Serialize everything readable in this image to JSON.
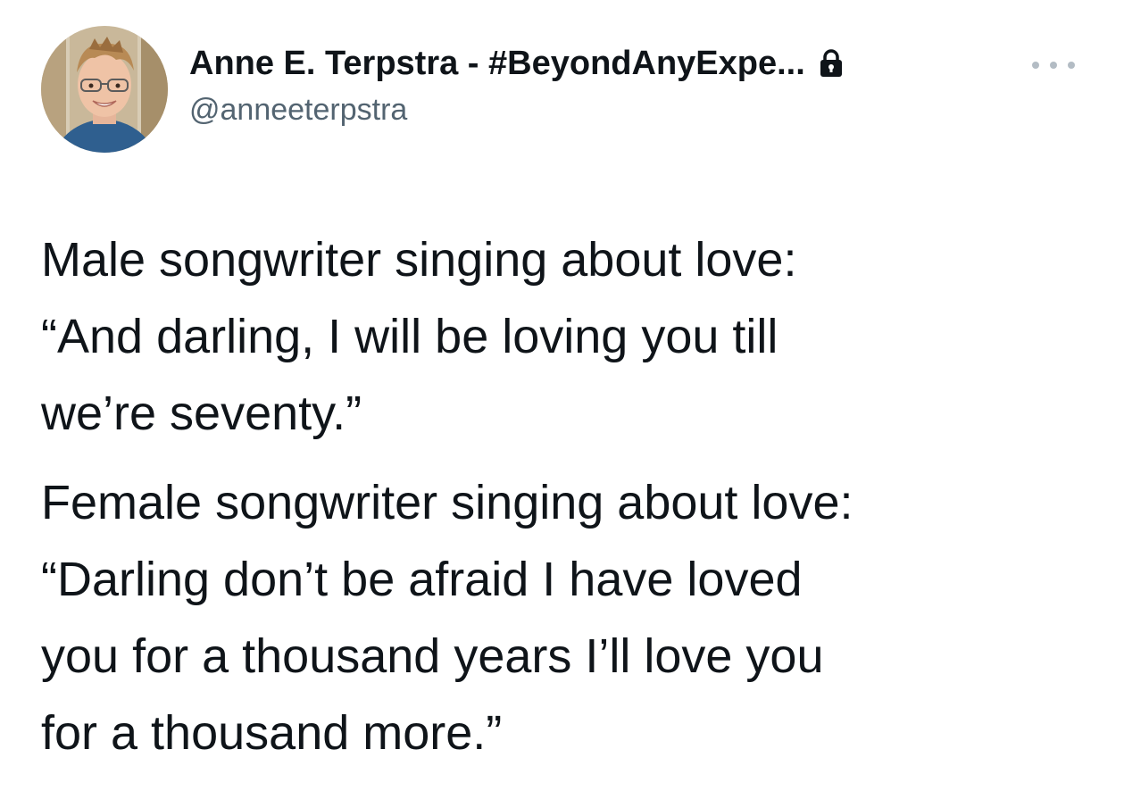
{
  "tweet": {
    "author": {
      "display_name": "Anne E. Terpstra - #BeyondAnyExpe...",
      "handle": "@anneeterpstra",
      "protected_icon": "lock-icon"
    },
    "more_icon": "more-horizontal-icon",
    "paragraphs": [
      "Male songwriter singing about love:\n“And darling, I will be loving you till\nwe’re seventy.”",
      "Female songwriter singing about love:\n“Darling don’t be afraid I have loved\nyou for a thousand years I’ll love you\nfor a thousand more.”"
    ]
  }
}
